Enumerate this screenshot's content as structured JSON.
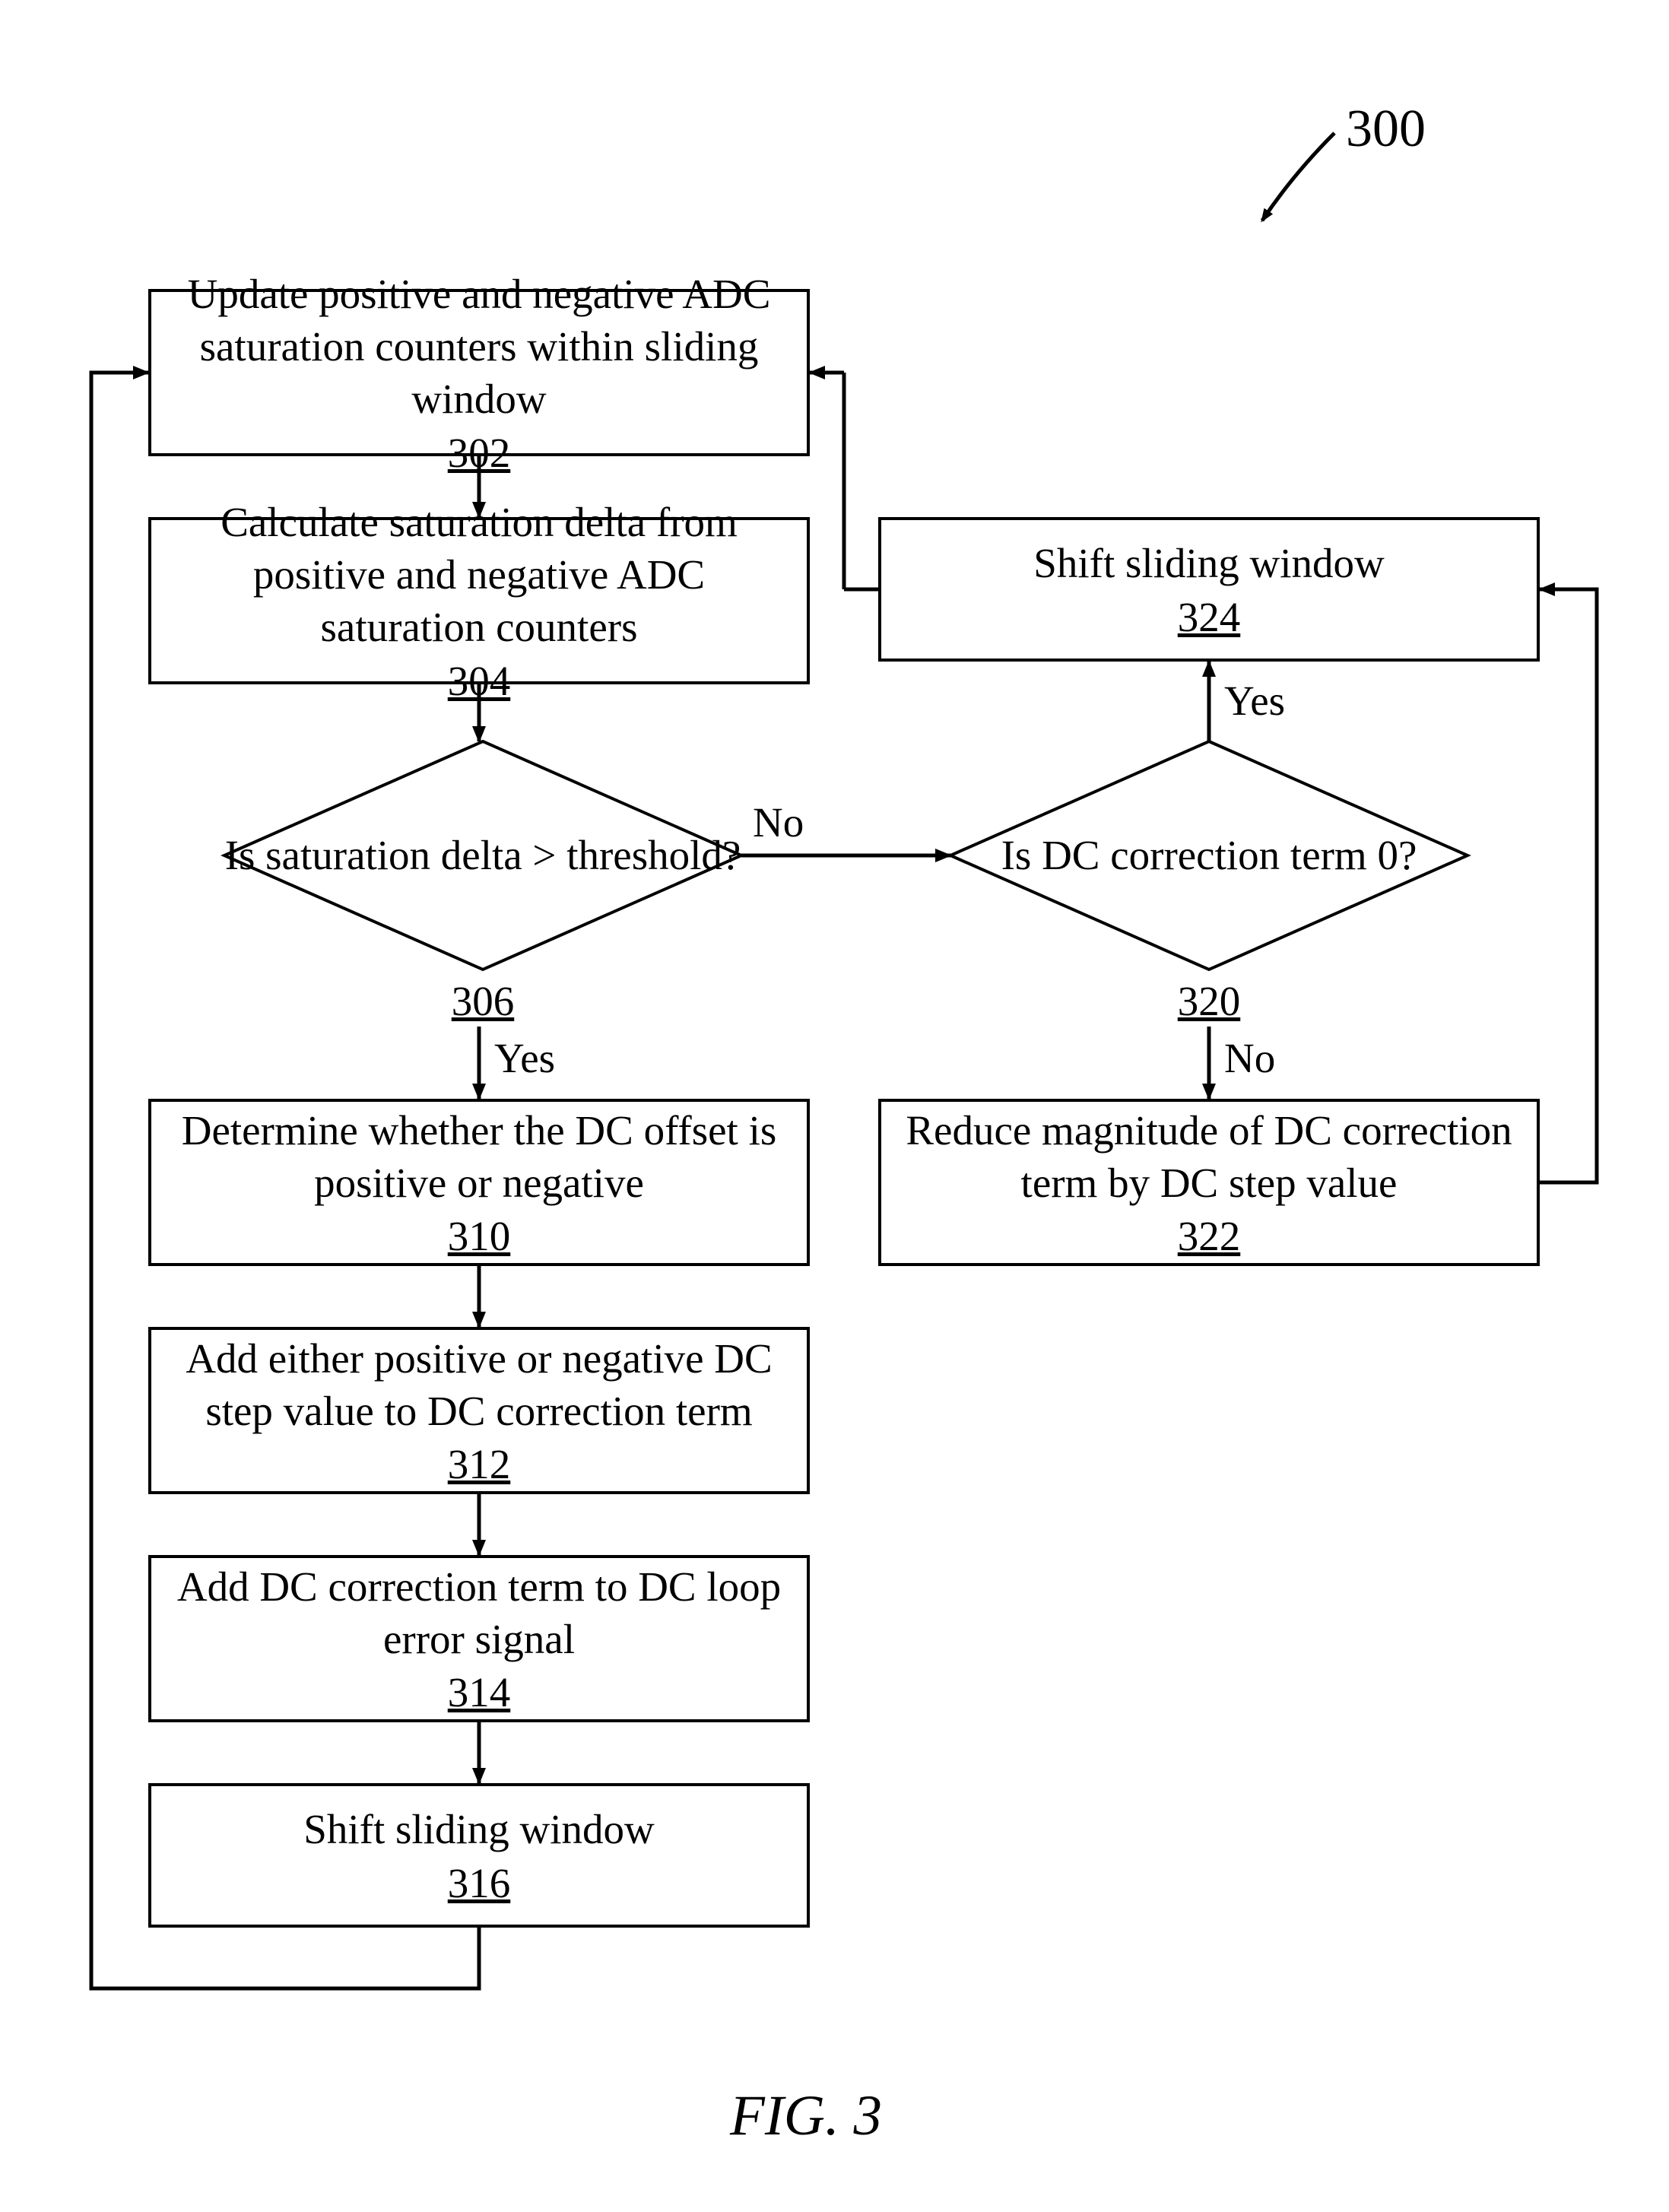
{
  "figure_ref": "300",
  "figure_label": "FIG. 3",
  "nodes": {
    "n302": {
      "text": "Update positive and negative ADC saturation counters within sliding window",
      "ref": "302"
    },
    "n304": {
      "text": "Calculate saturation delta from positive and negative ADC saturation counters",
      "ref": "304"
    },
    "n306": {
      "text": "Is saturation delta > threshold?",
      "ref": "306"
    },
    "n310": {
      "text": "Determine whether the DC offset is positive or negative",
      "ref": "310"
    },
    "n312": {
      "text": "Add either positive or negative DC step value to DC correction term",
      "ref": "312"
    },
    "n314": {
      "text": "Add DC correction term to DC loop error signal",
      "ref": "314"
    },
    "n316": {
      "text": "Shift sliding window",
      "ref": "316"
    },
    "n320": {
      "text": "Is DC correction term 0?",
      "ref": "320"
    },
    "n322": {
      "text": "Reduce magnitude of DC correction term by DC step value",
      "ref": "322"
    },
    "n324": {
      "text": "Shift sliding window",
      "ref": "324"
    }
  },
  "edges": {
    "e306_yes": "Yes",
    "e306_no": "No",
    "e320_yes": "Yes",
    "e320_no": "No"
  }
}
